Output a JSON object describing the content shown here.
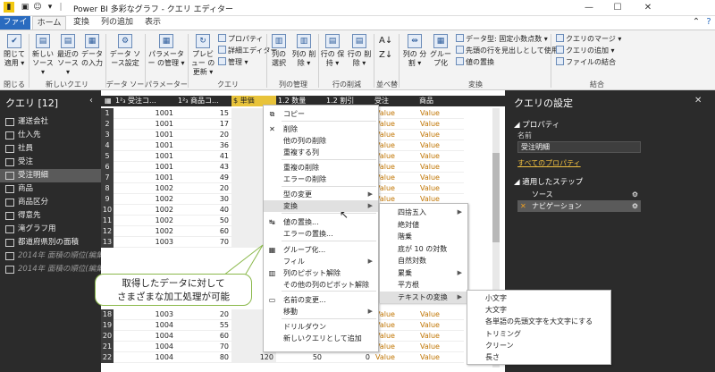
{
  "window": {
    "title": "Power BI 多彩なグラフ - クエリ エディター",
    "controls": [
      "—",
      "☐",
      "✕"
    ]
  },
  "tabs": [
    {
      "label": "ファイル"
    },
    {
      "label": "ホーム"
    },
    {
      "label": "変換"
    },
    {
      "label": "列の追加"
    },
    {
      "label": "表示"
    }
  ],
  "ribbon": {
    "buttons": [
      {
        "label": "閉じて 適用 ▾"
      },
      {
        "label": "新しい ソース ▾"
      },
      {
        "label": "最近の ソース ▾"
      },
      {
        "label": "データ の入力"
      },
      {
        "label": "データ ソース設定"
      },
      {
        "label": "パラメーター の管理 ▾"
      },
      {
        "label": "プレビュー の更新 ▾"
      },
      {
        "label": "列の 選択"
      },
      {
        "label": "列の 削除 ▾"
      },
      {
        "label": "行の 保持 ▾"
      },
      {
        "label": "行の 削除 ▾"
      },
      {
        "label": "列の 分割 ▾"
      },
      {
        "label": "グルー プ化"
      }
    ],
    "small": [
      {
        "label": "プロパティ"
      },
      {
        "label": "詳細エディター"
      },
      {
        "label": "管理 ▾"
      },
      {
        "label": "データ型: 固定小数点数 ▾"
      },
      {
        "label": "先頭の行を見出しとして使用 ▾"
      },
      {
        "label": "値の置換"
      },
      {
        "label": "クエリのマージ ▾"
      },
      {
        "label": "クエリの追加 ▾"
      },
      {
        "label": "ファイルの結合"
      }
    ],
    "groups": [
      {
        "label": "閉じる"
      },
      {
        "label": "新しいクエリ"
      },
      {
        "label": "データ ソース"
      },
      {
        "label": "パラメーター"
      },
      {
        "label": "クエリ"
      },
      {
        "label": "列の管理"
      },
      {
        "label": "行の削減"
      },
      {
        "label": "並べ替え"
      },
      {
        "label": "変換"
      },
      {
        "label": "結合"
      }
    ]
  },
  "queries": {
    "header": "クエリ [12]",
    "items": [
      {
        "label": "運送会社"
      },
      {
        "label": "仕入先"
      },
      {
        "label": "社員"
      },
      {
        "label": "受注"
      },
      {
        "label": "受注明細"
      },
      {
        "label": "商品"
      },
      {
        "label": "商品区分"
      },
      {
        "label": "得意先"
      },
      {
        "label": "滝グラフ用"
      },
      {
        "label": "都道府県別の面積"
      },
      {
        "label": "2014年 面積の順位(編集..."
      },
      {
        "label": "2014年 面積の順位(編集..."
      }
    ]
  },
  "grid": {
    "columns": [
      {
        "label": "1²₃ 受注コ..."
      },
      {
        "label": "1²₃ 商品コ..."
      },
      {
        "label": "$ 単価"
      },
      {
        "label": "1.2 数量"
      },
      {
        "label": "1.2 割引"
      },
      {
        "label": "受注"
      },
      {
        "label": "商品"
      }
    ],
    "rows": [
      {
        "n": "1",
        "a": "1001",
        "b": "15"
      },
      {
        "n": "2",
        "a": "1001",
        "b": "17"
      },
      {
        "n": "3",
        "a": "1001",
        "b": "20"
      },
      {
        "n": "4",
        "a": "1001",
        "b": "36"
      },
      {
        "n": "5",
        "a": "1001",
        "b": "41"
      },
      {
        "n": "6",
        "a": "1001",
        "b": "43"
      },
      {
        "n": "7",
        "a": "1001",
        "b": "49"
      },
      {
        "n": "8",
        "a": "1002",
        "b": "20"
      },
      {
        "n": "9",
        "a": "1002",
        "b": "30"
      },
      {
        "n": "10",
        "a": "1002",
        "b": "40"
      },
      {
        "n": "11",
        "a": "1002",
        "b": "50"
      },
      {
        "n": "12",
        "a": "1002",
        "b": "60"
      },
      {
        "n": "13",
        "a": "1003",
        "b": "70"
      },
      {
        "n": "14",
        "a": "1003",
        "b": "80"
      },
      {
        "n": "15",
        "a": "1003",
        "b": "90"
      },
      {
        "n": "16",
        "a": "1003",
        "b": "10"
      },
      {
        "n": "17",
        "a": "1004",
        "b": "45"
      },
      {
        "n": "18",
        "a": "1003",
        "b": "20"
      },
      {
        "n": "19",
        "a": "1004",
        "b": "55"
      },
      {
        "n": "20",
        "a": "1004",
        "b": "60"
      },
      {
        "n": "21",
        "a": "1004",
        "b": "70"
      },
      {
        "n": "22",
        "a": "1004",
        "b": "80"
      }
    ],
    "last_row": {
      "price": "120",
      "qty": "50",
      "disc": "0"
    },
    "value_text": "Value"
  },
  "context_menu": {
    "items": [
      {
        "label": "コピー",
        "icon": "⧉"
      },
      {
        "label": "削除",
        "icon": "✕"
      },
      {
        "label": "他の列の削除",
        "icon": ""
      },
      {
        "label": "重複する列",
        "icon": ""
      },
      {
        "label": "重複の削除",
        "icon": ""
      },
      {
        "label": "エラーの削除",
        "icon": ""
      },
      {
        "label": "型の変更",
        "icon": ""
      },
      {
        "label": "変換",
        "icon": ""
      },
      {
        "label": "値の置換...",
        "icon": "↹"
      },
      {
        "label": "エラーの置換...",
        "icon": ""
      },
      {
        "label": "グループ化...",
        "icon": "▦"
      },
      {
        "label": "フィル",
        "icon": ""
      },
      {
        "label": "列のピボット解除",
        "icon": "▥"
      },
      {
        "label": "その他の列のピボット解除",
        "icon": ""
      },
      {
        "label": "名前の変更...",
        "icon": "▭"
      },
      {
        "label": "移動",
        "icon": ""
      },
      {
        "label": "ドリルダウン",
        "icon": ""
      },
      {
        "label": "新しいクエリとして追加",
        "icon": ""
      }
    ],
    "arrow": "▶"
  },
  "transform_menu": {
    "items": [
      {
        "label": "四捨五入"
      },
      {
        "label": "絶対値"
      },
      {
        "label": "階乗"
      },
      {
        "label": "底が 10 の対数"
      },
      {
        "label": "自然対数"
      },
      {
        "label": "累乗"
      },
      {
        "label": "平方根"
      },
      {
        "label": "テキストの変換"
      }
    ]
  },
  "text_menu": {
    "items": [
      {
        "label": "小文字"
      },
      {
        "label": "大文字"
      },
      {
        "label": "各単語の先頭文字を大文字にする"
      },
      {
        "label": "トリミング"
      },
      {
        "label": "クリーン"
      },
      {
        "label": "長さ"
      }
    ]
  },
  "settings": {
    "header": "クエリの設定",
    "properties_title": "プロパティ",
    "name_label": "名前",
    "name_value": "受注明細",
    "all_props": "すべてのプロパティ",
    "steps_title": "適用したステップ",
    "steps": [
      {
        "label": "ソース"
      },
      {
        "label": "ナビゲーション"
      }
    ]
  },
  "callout": {
    "line1": "取得したデータに対して",
    "line2": "さまざまな加工処理が可能"
  }
}
